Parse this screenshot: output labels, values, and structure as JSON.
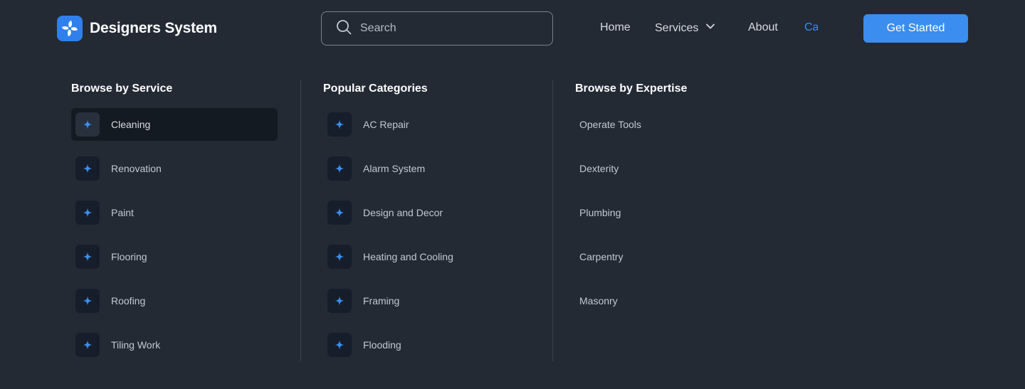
{
  "brand": {
    "name": "Designers System"
  },
  "search": {
    "placeholder": "Search"
  },
  "nav": {
    "home": "Home",
    "services": "Services",
    "about": "About",
    "partial": "Ca"
  },
  "cta": {
    "label": "Get Started"
  },
  "colors": {
    "accent": "#3b8df0",
    "background": "#232a34",
    "icon_star": "#3a8ef2"
  },
  "menu": {
    "service": {
      "title": "Browse by Service",
      "items": [
        "Cleaning",
        "Renovation",
        "Paint",
        "Flooring",
        "Roofing",
        "Tiling Work"
      ]
    },
    "categories": {
      "title": "Popular Categories",
      "items": [
        "AC Repair",
        "Alarm System",
        "Design and Decor",
        "Heating and Cooling",
        "Framing",
        "Flooding"
      ]
    },
    "expertise": {
      "title": "Browse by Expertise",
      "items": [
        "Operate Tools",
        "Dexterity",
        "Plumbing",
        "Carpentry",
        "Masonry"
      ]
    }
  }
}
